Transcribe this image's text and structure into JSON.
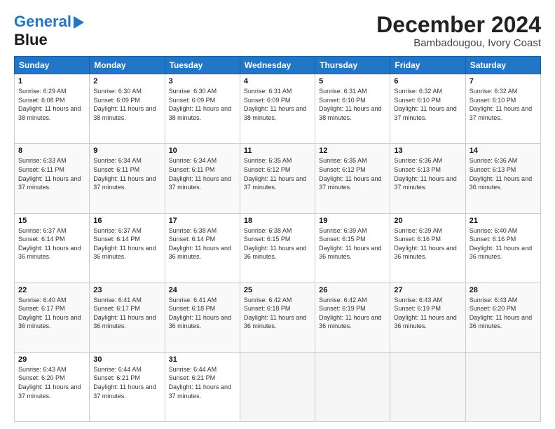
{
  "header": {
    "logo_line1": "General",
    "logo_line2": "Blue",
    "title": "December 2024",
    "location": "Bambadougou, Ivory Coast"
  },
  "days_of_week": [
    "Sunday",
    "Monday",
    "Tuesday",
    "Wednesday",
    "Thursday",
    "Friday",
    "Saturday"
  ],
  "weeks": [
    [
      {
        "day": 1,
        "sunrise": "6:29 AM",
        "sunset": "6:08 PM",
        "daylight": "11 hours and 38 minutes."
      },
      {
        "day": 2,
        "sunrise": "6:30 AM",
        "sunset": "6:09 PM",
        "daylight": "11 hours and 38 minutes."
      },
      {
        "day": 3,
        "sunrise": "6:30 AM",
        "sunset": "6:09 PM",
        "daylight": "11 hours and 38 minutes."
      },
      {
        "day": 4,
        "sunrise": "6:31 AM",
        "sunset": "6:09 PM",
        "daylight": "11 hours and 38 minutes."
      },
      {
        "day": 5,
        "sunrise": "6:31 AM",
        "sunset": "6:10 PM",
        "daylight": "11 hours and 38 minutes."
      },
      {
        "day": 6,
        "sunrise": "6:32 AM",
        "sunset": "6:10 PM",
        "daylight": "11 hours and 37 minutes."
      },
      {
        "day": 7,
        "sunrise": "6:32 AM",
        "sunset": "6:10 PM",
        "daylight": "11 hours and 37 minutes."
      }
    ],
    [
      {
        "day": 8,
        "sunrise": "6:33 AM",
        "sunset": "6:11 PM",
        "daylight": "11 hours and 37 minutes."
      },
      {
        "day": 9,
        "sunrise": "6:34 AM",
        "sunset": "6:11 PM",
        "daylight": "11 hours and 37 minutes."
      },
      {
        "day": 10,
        "sunrise": "6:34 AM",
        "sunset": "6:11 PM",
        "daylight": "11 hours and 37 minutes."
      },
      {
        "day": 11,
        "sunrise": "6:35 AM",
        "sunset": "6:12 PM",
        "daylight": "11 hours and 37 minutes."
      },
      {
        "day": 12,
        "sunrise": "6:35 AM",
        "sunset": "6:12 PM",
        "daylight": "11 hours and 37 minutes."
      },
      {
        "day": 13,
        "sunrise": "6:36 AM",
        "sunset": "6:13 PM",
        "daylight": "11 hours and 37 minutes."
      },
      {
        "day": 14,
        "sunrise": "6:36 AM",
        "sunset": "6:13 PM",
        "daylight": "11 hours and 36 minutes."
      }
    ],
    [
      {
        "day": 15,
        "sunrise": "6:37 AM",
        "sunset": "6:14 PM",
        "daylight": "11 hours and 36 minutes."
      },
      {
        "day": 16,
        "sunrise": "6:37 AM",
        "sunset": "6:14 PM",
        "daylight": "11 hours and 36 minutes."
      },
      {
        "day": 17,
        "sunrise": "6:38 AM",
        "sunset": "6:14 PM",
        "daylight": "11 hours and 36 minutes."
      },
      {
        "day": 18,
        "sunrise": "6:38 AM",
        "sunset": "6:15 PM",
        "daylight": "11 hours and 36 minutes."
      },
      {
        "day": 19,
        "sunrise": "6:39 AM",
        "sunset": "6:15 PM",
        "daylight": "11 hours and 36 minutes."
      },
      {
        "day": 20,
        "sunrise": "6:39 AM",
        "sunset": "6:16 PM",
        "daylight": "11 hours and 36 minutes."
      },
      {
        "day": 21,
        "sunrise": "6:40 AM",
        "sunset": "6:16 PM",
        "daylight": "11 hours and 36 minutes."
      }
    ],
    [
      {
        "day": 22,
        "sunrise": "6:40 AM",
        "sunset": "6:17 PM",
        "daylight": "11 hours and 36 minutes."
      },
      {
        "day": 23,
        "sunrise": "6:41 AM",
        "sunset": "6:17 PM",
        "daylight": "11 hours and 36 minutes."
      },
      {
        "day": 24,
        "sunrise": "6:41 AM",
        "sunset": "6:18 PM",
        "daylight": "11 hours and 36 minutes."
      },
      {
        "day": 25,
        "sunrise": "6:42 AM",
        "sunset": "6:18 PM",
        "daylight": "11 hours and 36 minutes."
      },
      {
        "day": 26,
        "sunrise": "6:42 AM",
        "sunset": "6:19 PM",
        "daylight": "11 hours and 36 minutes."
      },
      {
        "day": 27,
        "sunrise": "6:43 AM",
        "sunset": "6:19 PM",
        "daylight": "11 hours and 36 minutes."
      },
      {
        "day": 28,
        "sunrise": "6:43 AM",
        "sunset": "6:20 PM",
        "daylight": "11 hours and 36 minutes."
      }
    ],
    [
      {
        "day": 29,
        "sunrise": "6:43 AM",
        "sunset": "6:20 PM",
        "daylight": "11 hours and 37 minutes."
      },
      {
        "day": 30,
        "sunrise": "6:44 AM",
        "sunset": "6:21 PM",
        "daylight": "11 hours and 37 minutes."
      },
      {
        "day": 31,
        "sunrise": "6:44 AM",
        "sunset": "6:21 PM",
        "daylight": "11 hours and 37 minutes."
      },
      null,
      null,
      null,
      null
    ]
  ]
}
